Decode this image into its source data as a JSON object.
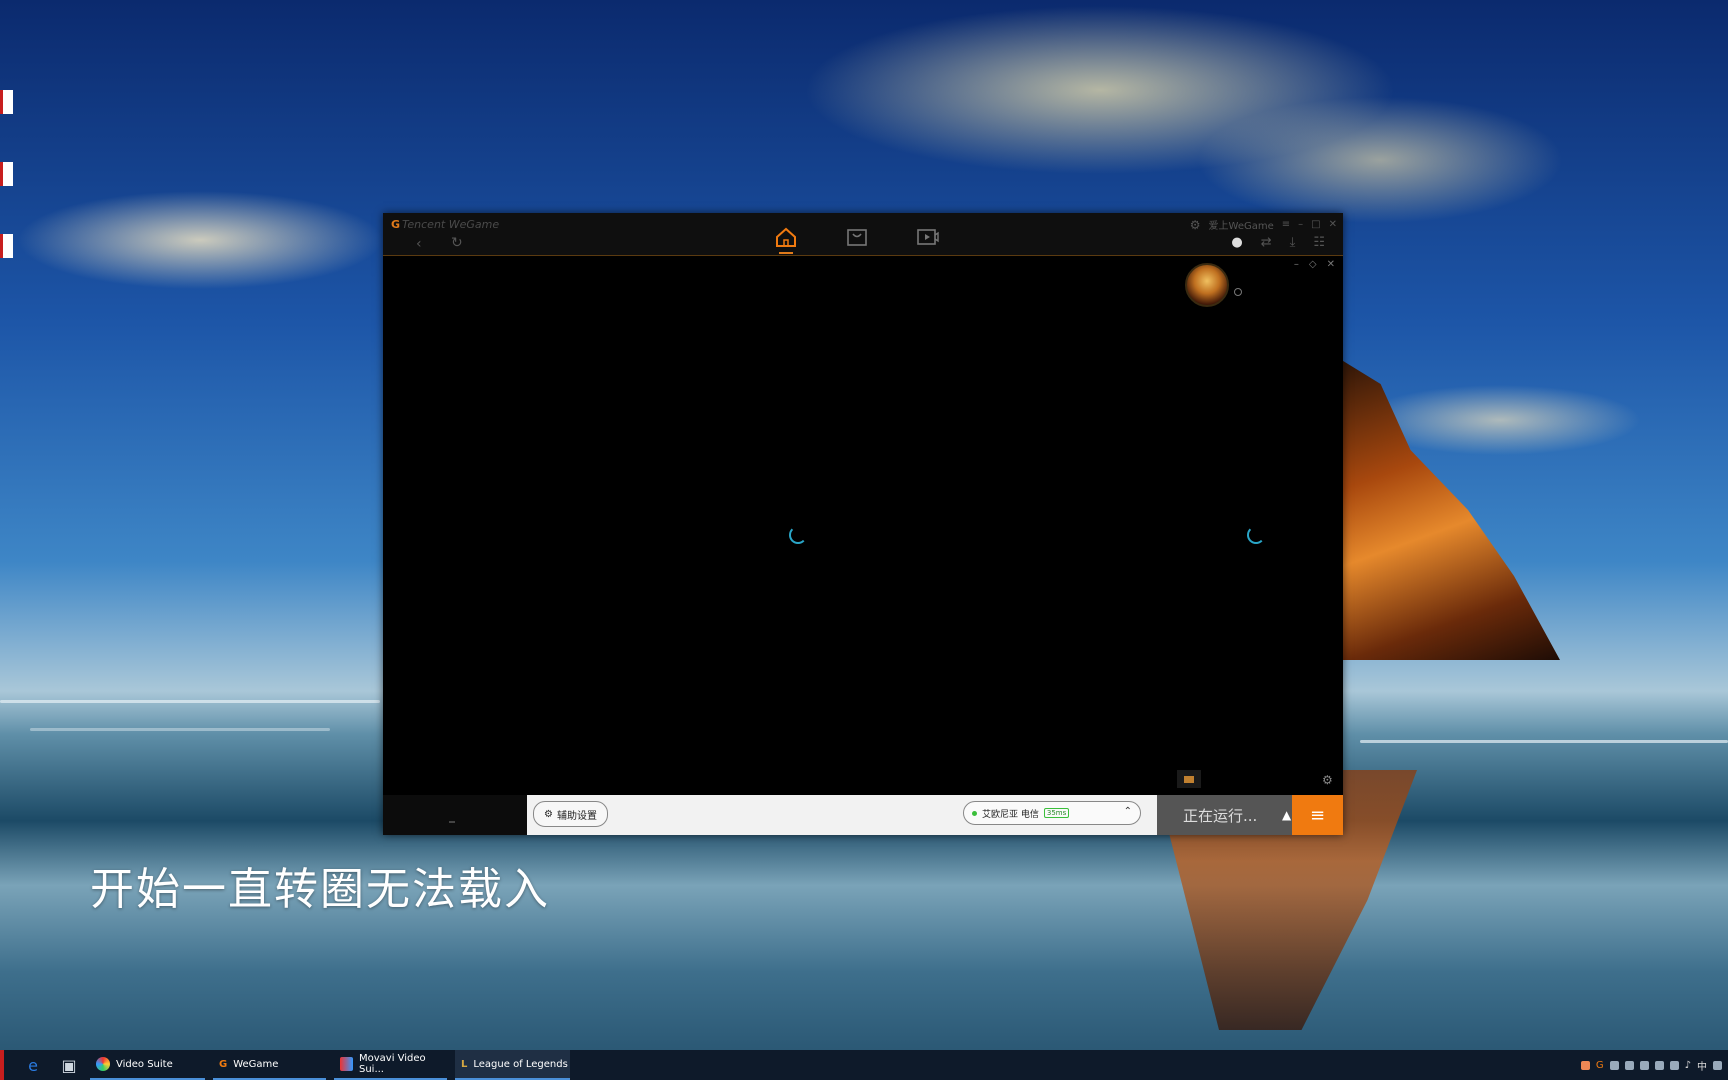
{
  "wegame": {
    "logo_text": "Tencent WeGame",
    "logo_mark": "G",
    "top_right_label": "爱上WeGame",
    "assist_settings_label": "辅助设置",
    "server": {
      "name": "艾欧尼亚 电信",
      "ping": "35ms"
    },
    "run_status": "正在运行..."
  },
  "subtitle": "开始一直转圈无法载入",
  "taskbar": {
    "apps": [
      {
        "label": "Video Suite"
      },
      {
        "label": "WeGame"
      },
      {
        "label": "Movavi Video Sui..."
      },
      {
        "label": "League of Legends"
      }
    ],
    "ime_label": "中"
  },
  "colors": {
    "accent": "#f07a10",
    "spinner": "#2aa6c8",
    "online": "#3bbf3b"
  }
}
